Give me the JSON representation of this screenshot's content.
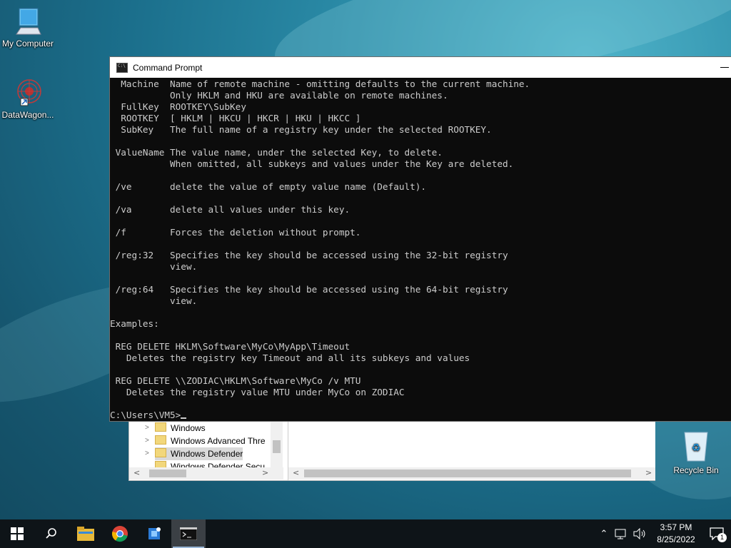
{
  "desktop": {
    "icons": [
      {
        "label": "My Computer",
        "icon": "monitor-icon"
      },
      {
        "label": "DataWagon...",
        "icon": "datawagon-shortcut-icon"
      },
      {
        "label": "Recycle Bin",
        "icon": "recycle-bin-icon"
      }
    ]
  },
  "regedit": {
    "tree_items": [
      "Windows",
      "Windows Advanced Thre",
      "Windows Defender",
      "Windows Defender Secu"
    ],
    "selected": "Windows Defender"
  },
  "cmd": {
    "title": "Command Prompt",
    "lines": [
      "  Machine  Name of remote machine - omitting defaults to the current machine.",
      "           Only HKLM and HKU are available on remote machines.",
      "  FullKey  ROOTKEY\\SubKey",
      "  ROOTKEY  [ HKLM | HKCU | HKCR | HKU | HKCC ]",
      "  SubKey   The full name of a registry key under the selected ROOTKEY.",
      "",
      " ValueName The value name, under the selected Key, to delete.",
      "           When omitted, all subkeys and values under the Key are deleted.",
      "",
      " /ve       delete the value of empty value name (Default).",
      "",
      " /va       delete all values under this key.",
      "",
      " /f        Forces the deletion without prompt.",
      "",
      " /reg:32   Specifies the key should be accessed using the 32-bit registry",
      "           view.",
      "",
      " /reg:64   Specifies the key should be accessed using the 64-bit registry",
      "           view.",
      "",
      "Examples:",
      "",
      " REG DELETE HKLM\\Software\\MyCo\\MyApp\\Timeout",
      "   Deletes the registry key Timeout and all its subkeys and values",
      "",
      " REG DELETE \\\\ZODIAC\\HKLM\\Software\\MyCo /v MTU",
      "   Deletes the registry value MTU under MyCo on ZODIAC",
      ""
    ],
    "prompt": "C:\\Users\\VM5>"
  },
  "taskbar": {
    "buttons": [
      "start-icon",
      "search-icon",
      "file-explorer-icon",
      "chrome-icon",
      "datawagon-icon",
      "command-prompt-icon"
    ],
    "time": "3:57 PM",
    "date": "8/25/2022",
    "notification_count": "1"
  }
}
